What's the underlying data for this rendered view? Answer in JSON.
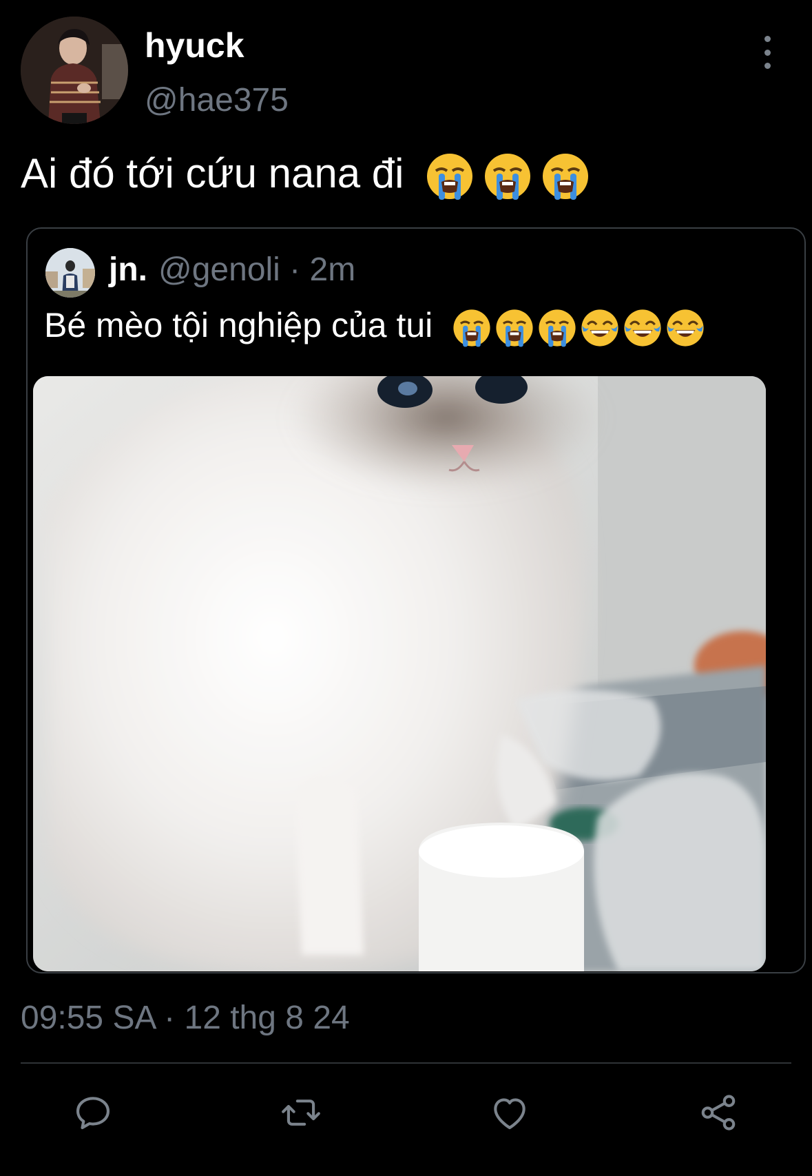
{
  "author": {
    "display_name": "hyuck",
    "handle": "@hae375"
  },
  "tweet": {
    "text": "Ai đó tới cứu nana đi",
    "emojis": [
      "loudly-crying-face",
      "loudly-crying-face",
      "loudly-crying-face"
    ]
  },
  "quoted_tweet": {
    "name": "jn.",
    "handle_and_time": "@genoli · 2m",
    "text": "Bé mèo tội nghiệp của tui",
    "emojis": [
      "loudly-crying-face",
      "loudly-crying-face",
      "loudly-crying-face",
      "face-with-tears-of-joy",
      "face-with-tears-of-joy",
      "face-with-tears-of-joy"
    ],
    "media": "photo-of-white-ragdoll-cat"
  },
  "timestamp": "09:55 SA · 12 thg 8 24",
  "actions": {
    "reply_icon": "reply-icon",
    "retweet_icon": "retweet-icon",
    "like_icon": "like-icon",
    "share_icon": "share-icon"
  },
  "colors": {
    "background": "#000000",
    "text_primary": "#ffffff",
    "text_secondary": "#6e7681",
    "border": "#3a3f44",
    "icon": "#7b838c"
  }
}
